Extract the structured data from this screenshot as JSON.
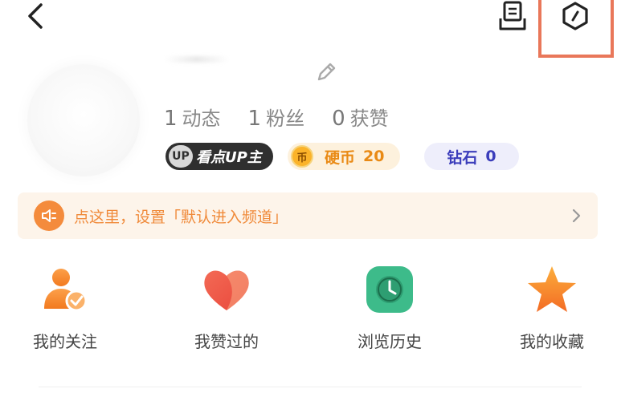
{
  "header": {
    "back_icon": "chevron-left-icon",
    "doc_icon": "document-tray-icon",
    "hex_icon": "hexagon-settings-icon"
  },
  "profile": {
    "edit_icon": "pencil-icon",
    "stats": [
      {
        "value": "1",
        "label": "动态"
      },
      {
        "value": "1",
        "label": "粉丝"
      },
      {
        "value": "0",
        "label": "获赞"
      }
    ],
    "badges": {
      "up_mark": "UP",
      "up_text": "看点UP主",
      "coin_mark": "币",
      "coin_label": "硬币",
      "coin_value": "20",
      "diamond_label": "钻石",
      "diamond_value": "0"
    }
  },
  "notice": {
    "text": "点这里，设置「默认进入频道」"
  },
  "shortcuts": [
    {
      "label": "我的关注",
      "icon": "person-check-icon"
    },
    {
      "label": "我赞过的",
      "icon": "heart-icon"
    },
    {
      "label": "浏览历史",
      "icon": "clock-icon"
    },
    {
      "label": "我的收藏",
      "icon": "star-icon"
    }
  ],
  "colors": {
    "accent_orange": "#f48b3c",
    "highlight_box": "#e9775a",
    "coin_text": "#e98a15",
    "diamond_text": "#3b3dbb",
    "history_green": "#3dbb8a",
    "heart_red": "#f05a4a"
  }
}
